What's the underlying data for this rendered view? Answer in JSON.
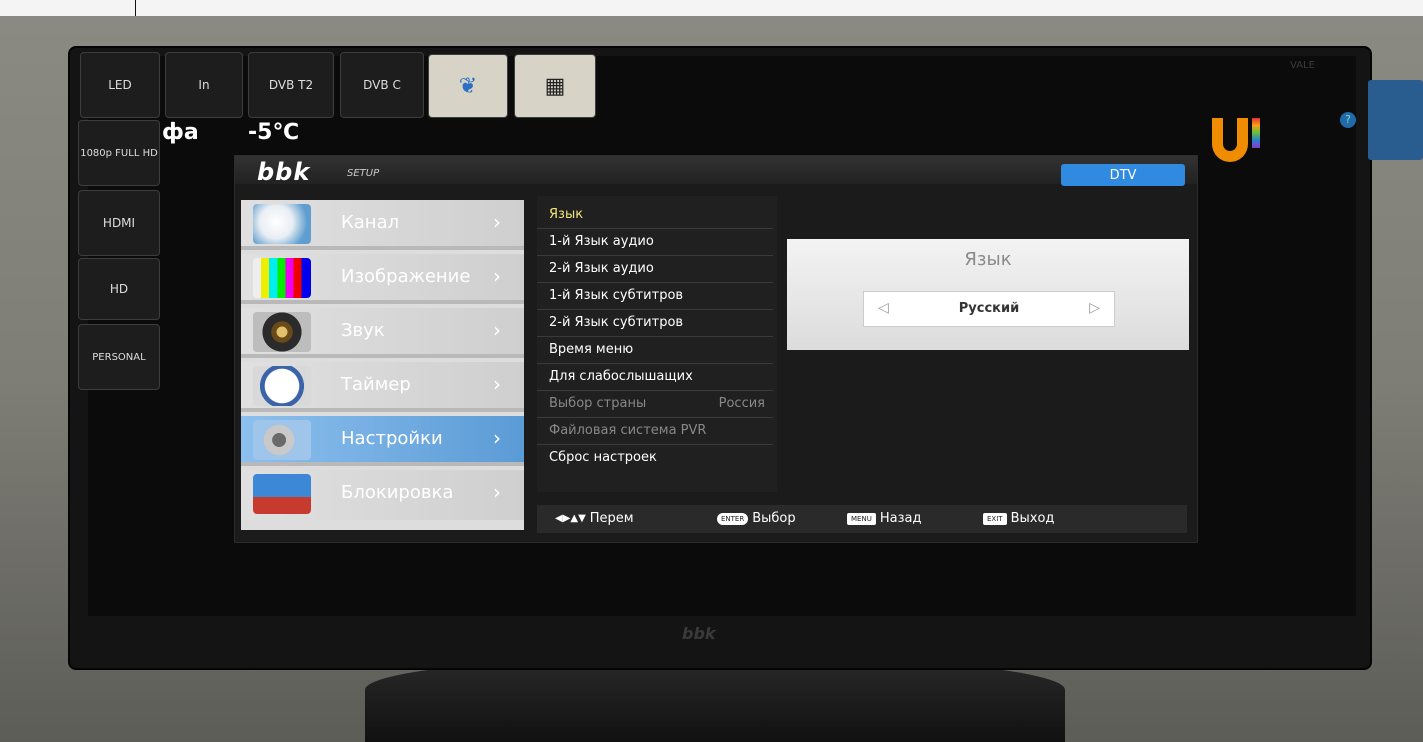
{
  "badges": {
    "led": "LED",
    "in": "In",
    "dvbt2": "DVB T2",
    "dvbc": "DVB C",
    "fullhd": "1080p FULL HD",
    "hdmi": "HDMI",
    "hd": "HD",
    "personal": "PERSONAL"
  },
  "overlay": {
    "fa": "фа",
    "temperature": "-5℃"
  },
  "brand": {
    "bbk": "bbk",
    "setup": "SETUP",
    "bezel_logo": "bbk",
    "vale": "VALE"
  },
  "source": "DTV",
  "categories": [
    {
      "label": "Канал",
      "icon": "satellite-dish-icon"
    },
    {
      "label": "Изображение",
      "icon": "test-pattern-icon"
    },
    {
      "label": "Звук",
      "icon": "speaker-icon"
    },
    {
      "label": "Таймер",
      "icon": "clock-icon"
    },
    {
      "label": "Настройки",
      "icon": "settings-tools-icon",
      "selected": true
    },
    {
      "label": "Блокировка",
      "icon": "lock-monitor-icon"
    }
  ],
  "options": [
    {
      "label": "Язык",
      "state": "highlighted"
    },
    {
      "label": "1-й Язык аудио"
    },
    {
      "label": "2-й Язык аудио"
    },
    {
      "label": "1-й Язык субтитров"
    },
    {
      "label": "2-й Язык субтитров"
    },
    {
      "label": "Время меню"
    },
    {
      "label": "Для слабослышащих"
    },
    {
      "label": "Выбор страны",
      "value": "Россия",
      "state": "disabled"
    },
    {
      "label": "Файловая система PVR",
      "state": "disabled"
    },
    {
      "label": "Сброс настроек"
    }
  ],
  "panel": {
    "title": "Язык",
    "value": "Русский"
  },
  "footer": {
    "move": "Перем",
    "enter_key": "ENTER",
    "select": "Выбор",
    "menu_key": "MENU",
    "back": "Назад",
    "exit_key": "EXIT",
    "exit": "Выход"
  },
  "colors": {
    "accent": "#2f8ae0",
    "selected_category": "#5b9bd6",
    "highlight_text": "#f2e47a"
  }
}
